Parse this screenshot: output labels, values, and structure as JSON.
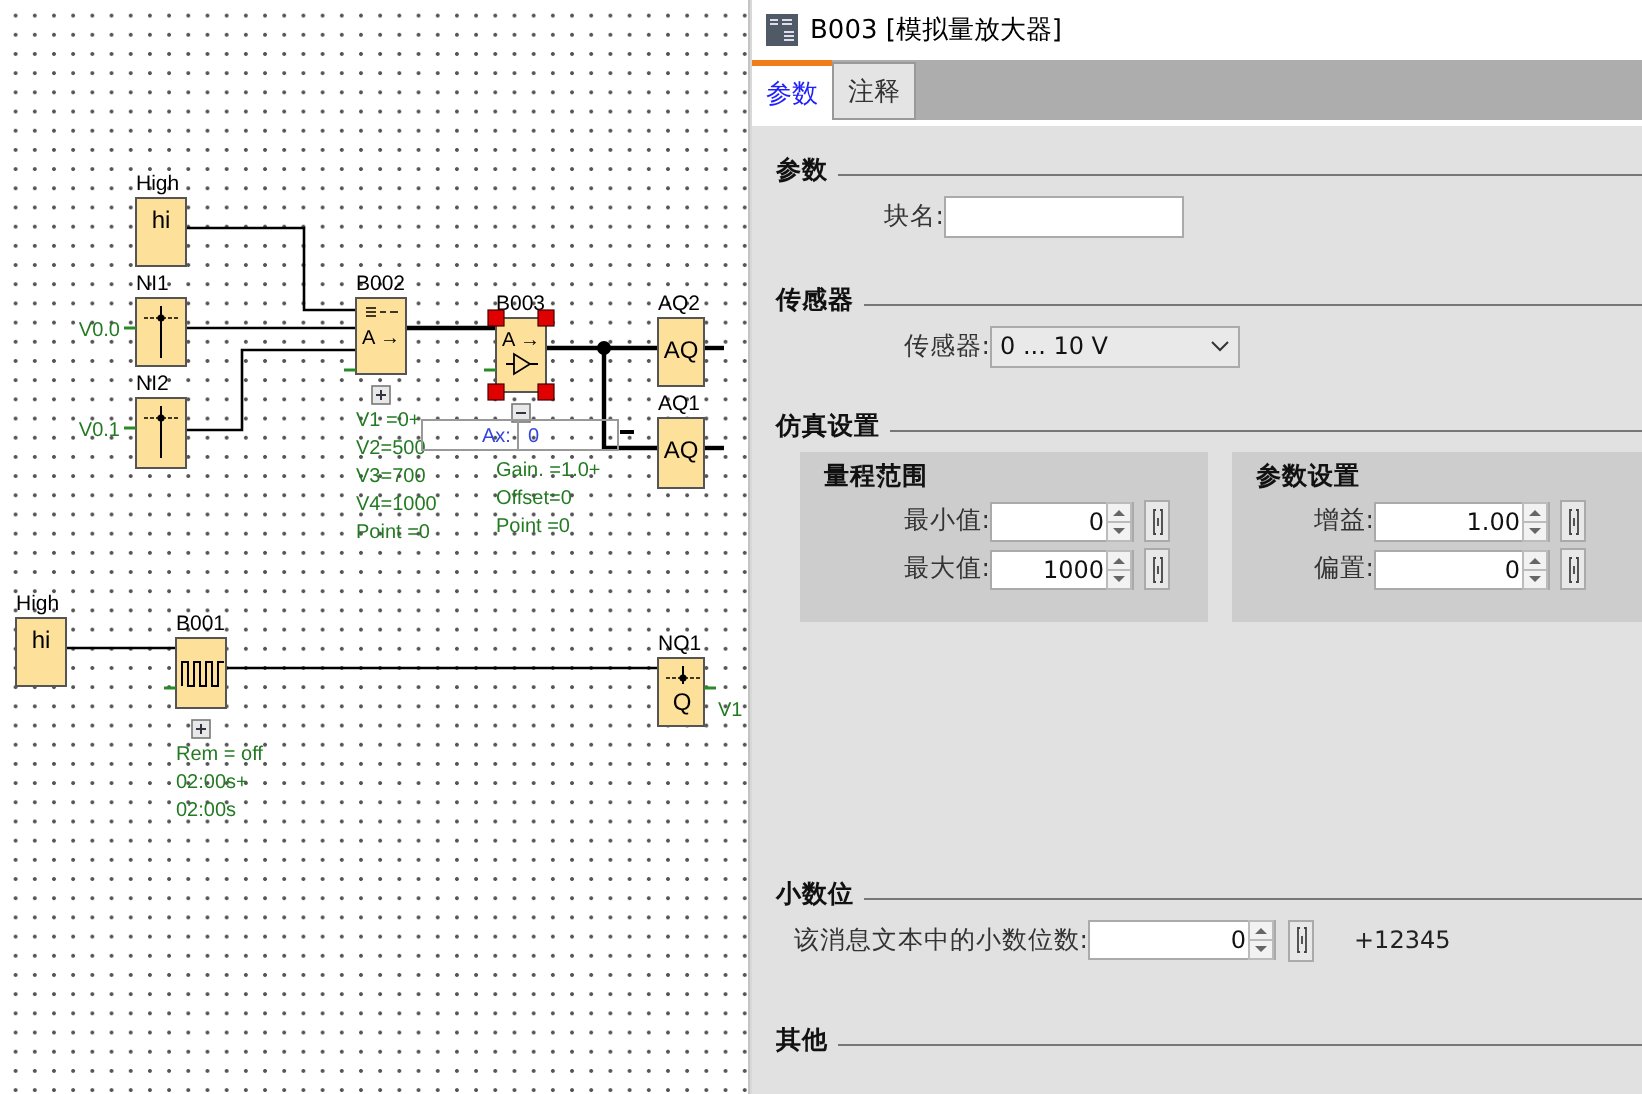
{
  "diagram": {
    "blocks": [
      {
        "kind": "constant",
        "label": "High",
        "symbol": "hi",
        "selected": false
      },
      {
        "kind": "input",
        "label": "NI1",
        "terminal": "V0.0",
        "selected": false
      },
      {
        "kind": "input",
        "label": "NI2",
        "terminal": "V0.1",
        "selected": false
      },
      {
        "kind": "scaler",
        "label": "B002",
        "symbol": "A →",
        "expanded": false,
        "selected": false,
        "params": [
          "V1 =0+",
          "V2=500",
          "V3=700",
          "V4=1000",
          "Point =0"
        ]
      },
      {
        "kind": "amplifier",
        "label": "B003",
        "symbol": "A →",
        "expanded": true,
        "selected": true,
        "params": [
          "Gain. =1.0+",
          "Offset=0",
          "Point =0"
        ]
      },
      {
        "kind": "analog-output",
        "label": "AQ2",
        "symbol": "AQ",
        "selected": false
      },
      {
        "kind": "analog-output",
        "label": "AQ1",
        "symbol": "AQ",
        "selected": false
      },
      {
        "kind": "constant",
        "label": "High",
        "symbol": "hi",
        "selected": false
      },
      {
        "kind": "pulse",
        "label": "B001",
        "expanded": false,
        "selected": false,
        "params": [
          "Rem = off",
          "02:00s+",
          "02:00s"
        ]
      },
      {
        "kind": "network-output",
        "label": "NQ1",
        "symbol": "Q",
        "terminal": "V1",
        "selected": false
      }
    ],
    "ax_box": {
      "label": "Ax:",
      "value": "0"
    }
  },
  "panel": {
    "title": "B003 [模拟量放大器]",
    "tabs": [
      {
        "label": "参数",
        "selected": true
      },
      {
        "label": "注释",
        "selected": false
      }
    ],
    "sections": [
      {
        "heading": "参数",
        "fields": [
          {
            "kind": "text",
            "label": "块名:"
          }
        ]
      },
      {
        "heading": "传感器",
        "fields": [
          {
            "kind": "select",
            "label": "传感器:",
            "value": "0 ... 10 V"
          }
        ]
      },
      {
        "heading": "仿真设置",
        "groups": [
          {
            "heading": "量程范围",
            "fields": [
              {
                "kind": "spin",
                "label": "最小值:",
                "value": "0"
              },
              {
                "kind": "spin",
                "label": "最大值:",
                "value": "1000"
              }
            ]
          },
          {
            "heading": "参数设置",
            "fields": [
              {
                "kind": "spin",
                "label": "增益:",
                "value": "1.00"
              },
              {
                "kind": "spin",
                "label": "偏置:",
                "value": "0"
              }
            ]
          }
        ]
      },
      {
        "heading": "小数位",
        "fields": [
          {
            "kind": "spin",
            "label": "该消息文本中的小数位数:",
            "value": "0",
            "preview": "+12345"
          }
        ]
      },
      {
        "heading": "其他"
      }
    ]
  }
}
